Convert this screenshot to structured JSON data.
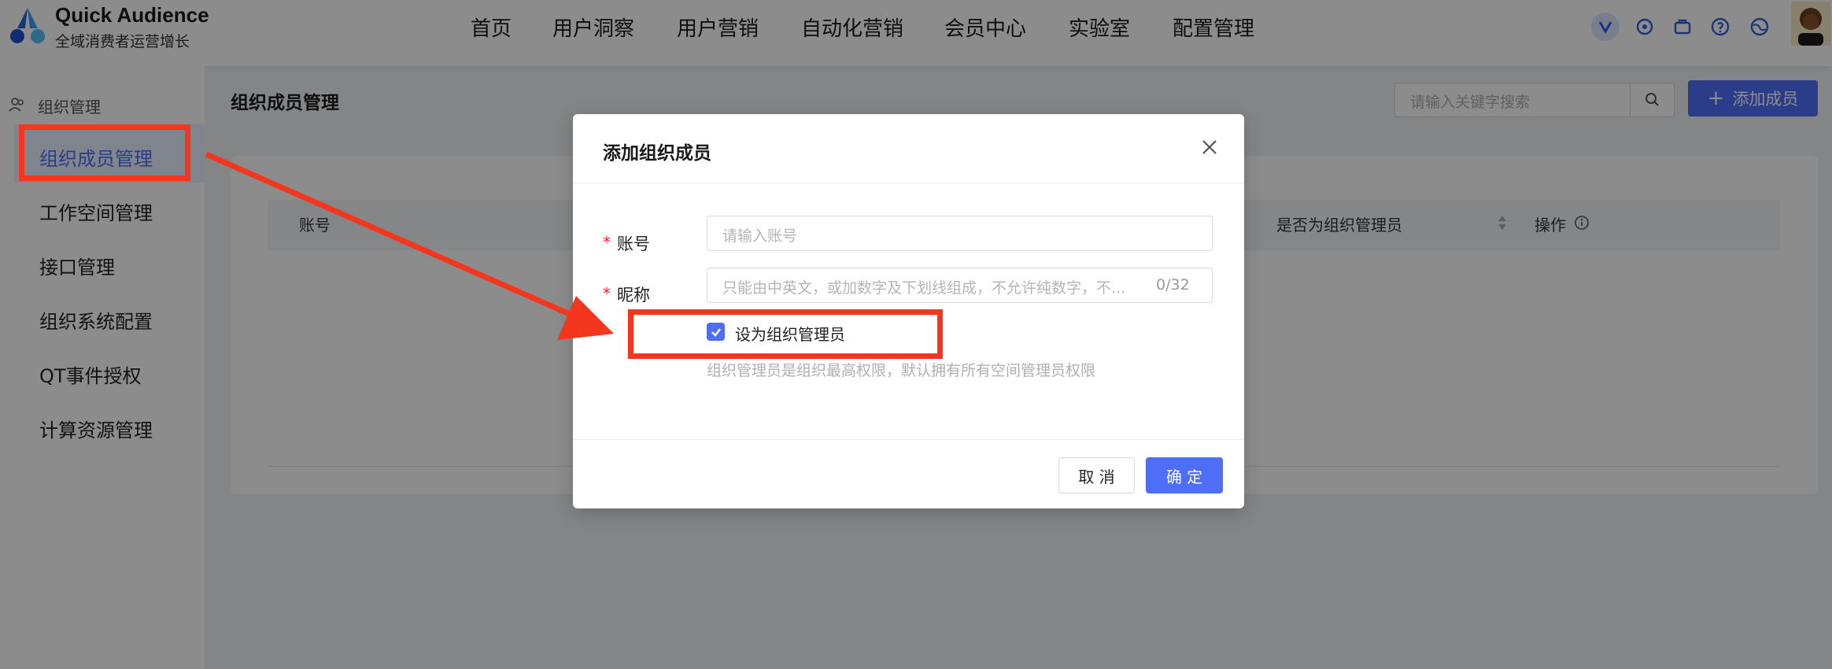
{
  "app": {
    "title": "Quick Audience",
    "subtitle": "全域消费者运营增长"
  },
  "nav": {
    "items": [
      {
        "label": "首页"
      },
      {
        "label": "用户洞察"
      },
      {
        "label": "用户营销"
      },
      {
        "label": "自动化营销"
      },
      {
        "label": "会员中心"
      },
      {
        "label": "实验室"
      },
      {
        "label": "配置管理"
      }
    ]
  },
  "header_icons": [
    "v-badge-icon",
    "settings-heart-icon",
    "briefcase-icon",
    "help-icon",
    "globe-icon",
    "avatar"
  ],
  "sidebar": {
    "group_label": "组织管理",
    "items": [
      {
        "label": "组织成员管理",
        "active": true
      },
      {
        "label": "工作空间管理"
      },
      {
        "label": "接口管理"
      },
      {
        "label": "组织系统配置"
      },
      {
        "label": "QT事件授权"
      },
      {
        "label": "计算资源管理"
      }
    ]
  },
  "main": {
    "title": "组织成员管理",
    "search_placeholder": "请输入关键字搜索",
    "add_button": "添加成员",
    "table": {
      "columns": [
        "账号",
        "是否为组织管理员",
        "操作"
      ]
    }
  },
  "modal": {
    "title": "添加组织成员",
    "account": {
      "required_mark": "*",
      "label": "账号",
      "placeholder": "请输入账号"
    },
    "nickname": {
      "required_mark": "*",
      "label": "昵称",
      "placeholder": "只能由中英文，或加数字及下划线组成，不允许纯数字，不...",
      "counter": "0/32"
    },
    "admin_checkbox": {
      "label": "设为组织管理员",
      "checked": true
    },
    "hint": "组织管理员是组织最高权限，默认拥有所有空间管理员权限",
    "cancel": "取 消",
    "confirm": "确 定"
  },
  "colors": {
    "primary": "#4f6ef7",
    "annotation": "#f4361e",
    "required": "#f5222d"
  }
}
